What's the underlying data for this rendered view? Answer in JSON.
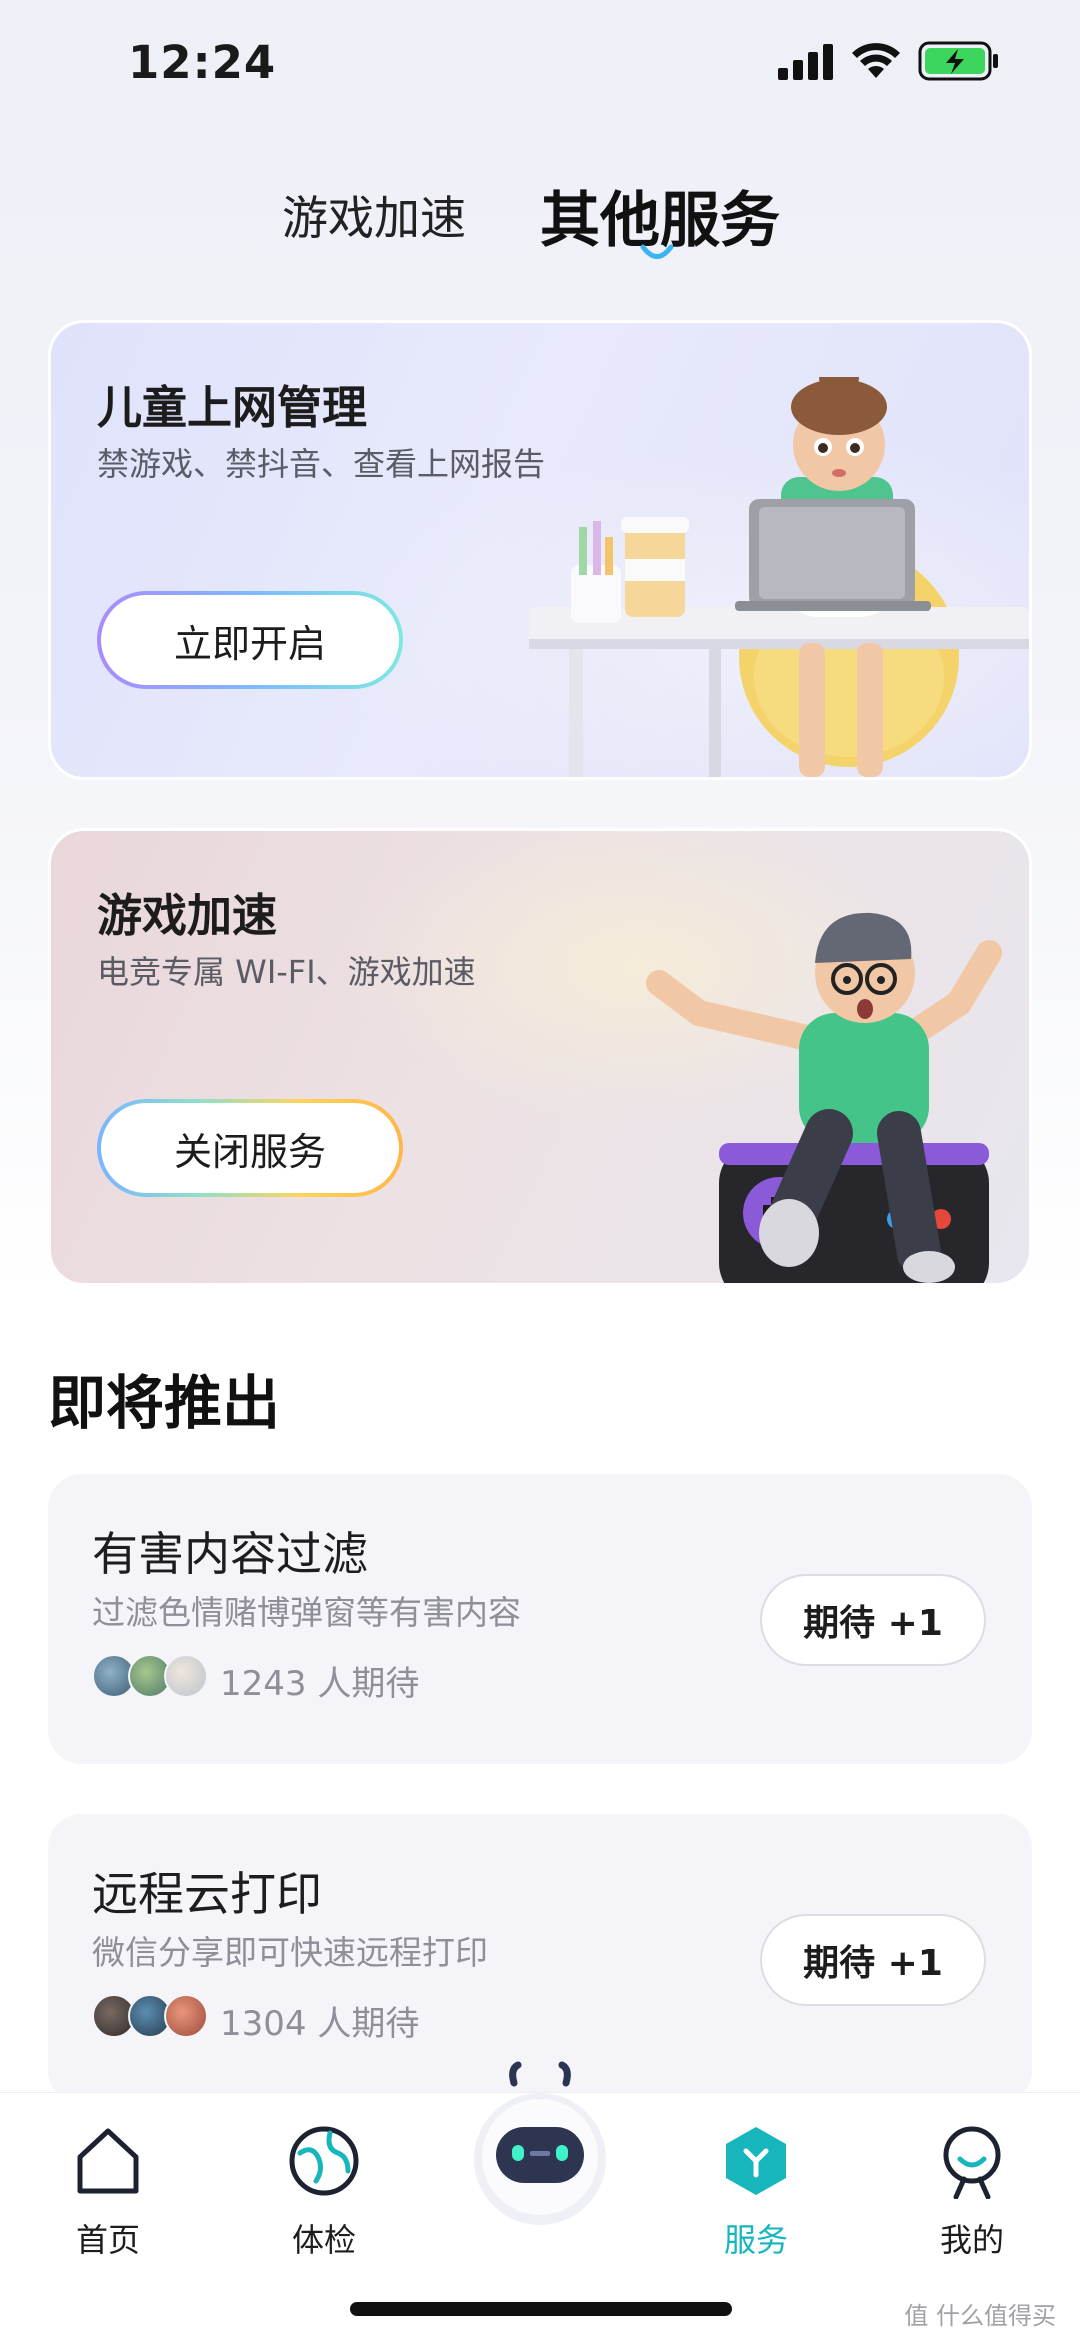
{
  "status_bar": {
    "time": "12:24",
    "icons": [
      "cellular-signal-icon",
      "wifi-icon",
      "battery-charging-icon"
    ],
    "battery_color": "#3dd65c"
  },
  "top_tabs": {
    "items": [
      {
        "label": "游戏加速",
        "active": false
      },
      {
        "label": "其他服务",
        "active": true
      }
    ],
    "indicator_color": "#3ab4f2"
  },
  "feature_cards": [
    {
      "title": "儿童上网管理",
      "subtitle": "禁游戏、禁抖音、查看上网报告",
      "button_label": "立即开启",
      "illustration": "girl-at-laptop-illustration"
    },
    {
      "title": "游戏加速",
      "subtitle": "电竞专属 WI-FI、游戏加速",
      "button_label": "关闭服务",
      "illustration": "boy-on-gamepad-illustration"
    }
  ],
  "coming_soon": {
    "title": "即将推出",
    "items": [
      {
        "title": "有害内容过滤",
        "subtitle": "过滤色情赌博弹窗等有害内容",
        "count_text": "1243 人期待",
        "button_label": "期待 +1"
      },
      {
        "title": "远程云打印",
        "subtitle": "微信分享即可快速远程打印",
        "count_text": "1304 人期待",
        "button_label": "期待 +1"
      }
    ]
  },
  "bottom_nav": {
    "items": [
      {
        "label": "首页",
        "icon": "home-icon",
        "active": false
      },
      {
        "label": "体检",
        "icon": "globe-check-icon",
        "active": false
      },
      {
        "label": "",
        "icon": "robot-assistant-icon",
        "active": false
      },
      {
        "label": "服务",
        "icon": "service-hexagon-icon",
        "active": true
      },
      {
        "label": "我的",
        "icon": "profile-smile-icon",
        "active": false
      }
    ],
    "active_color": "#17b6bd"
  },
  "watermark": "值 什么值得买"
}
